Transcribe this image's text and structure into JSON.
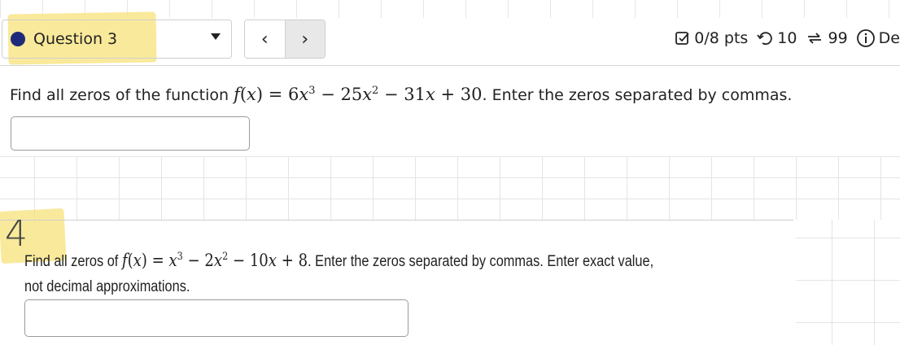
{
  "header": {
    "question_label": "Question 3",
    "prev_label": "‹",
    "next_label": "›",
    "score": "0/8 pts",
    "retries": "10",
    "attempts": "99",
    "details_partial": "De"
  },
  "question3": {
    "prefix": "Find all zeros of the function ",
    "suffix": ". Enter the zeros separated by commas.",
    "answer_value": ""
  },
  "question4": {
    "handwritten_number": "4",
    "prefix": "Find all zeros of ",
    "suffix": ". Enter the zeros separated by commas. Enter exact value, not decimal approximations.",
    "answer_value": ""
  },
  "colors": {
    "question_dot": "#1f2a7a",
    "highlight": "#f7e27a"
  }
}
